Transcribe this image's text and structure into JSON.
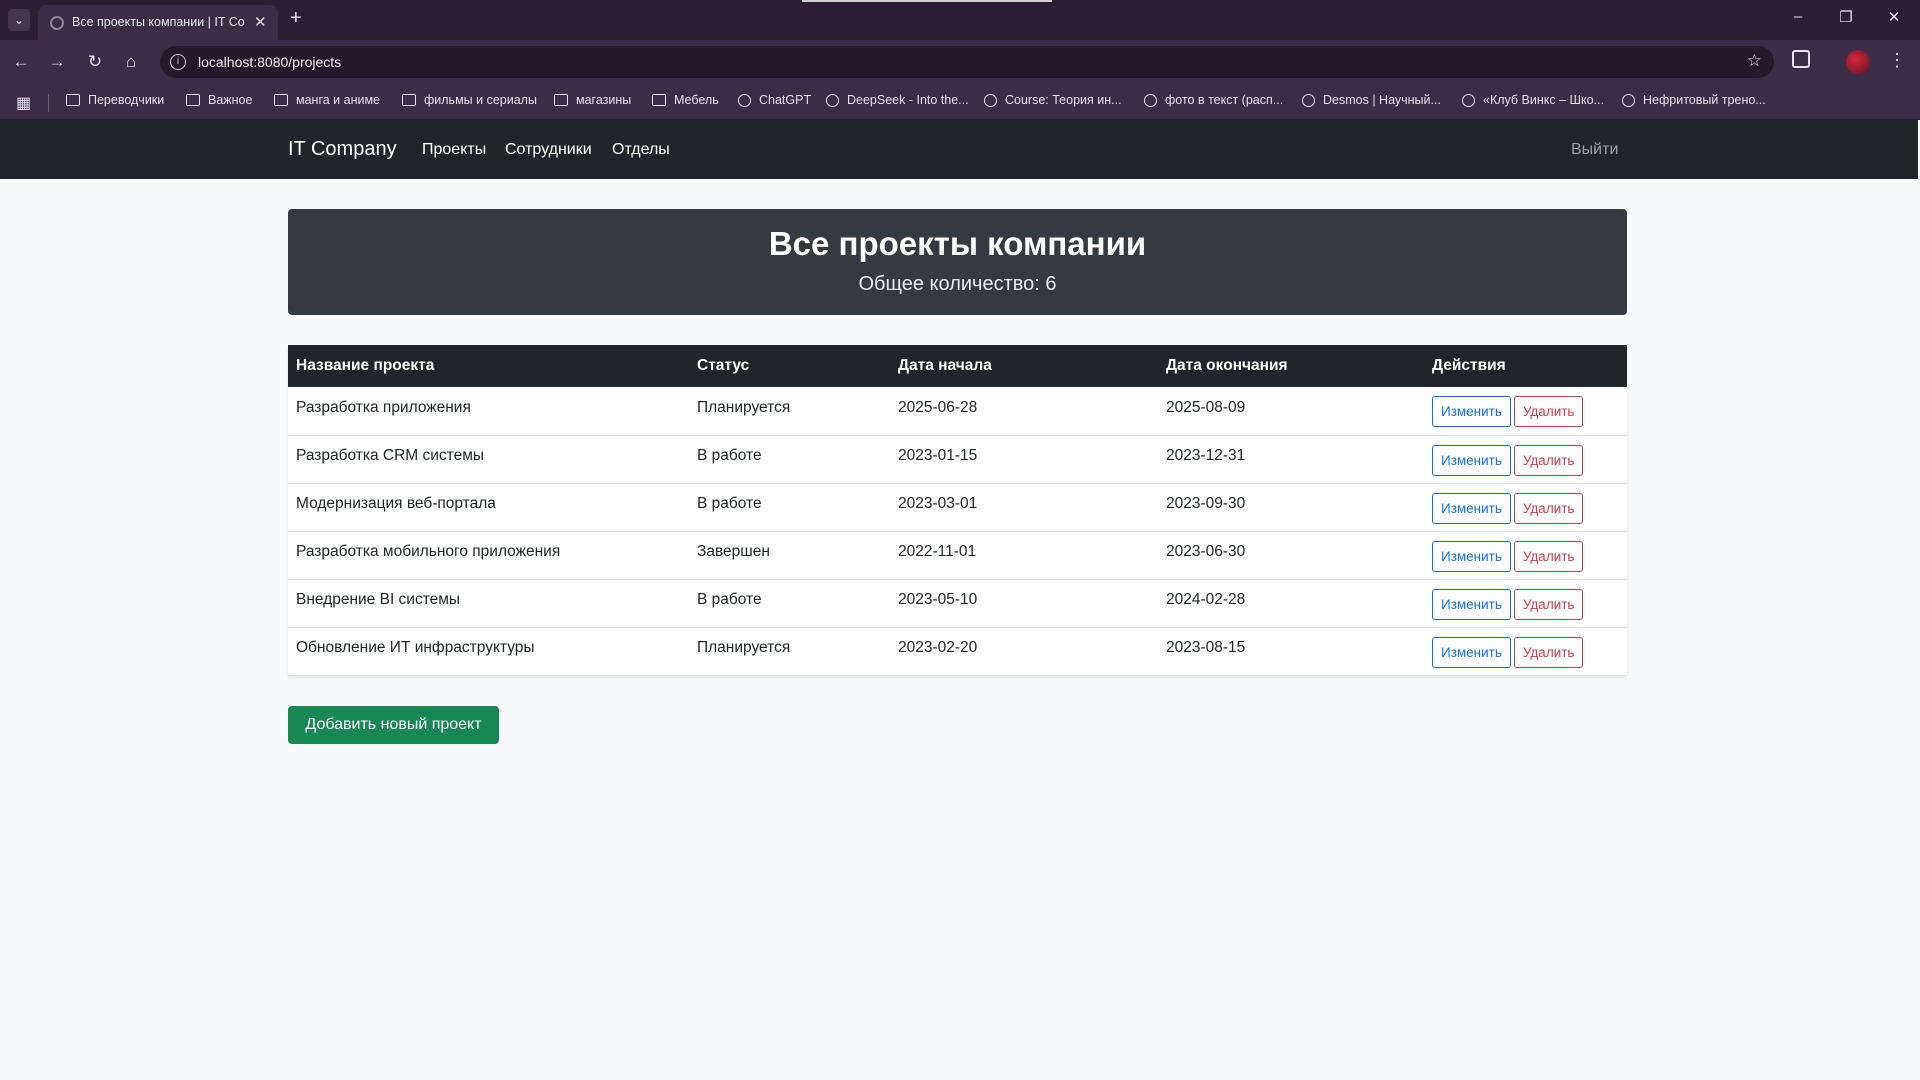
{
  "browser": {
    "tab_title": "Все проекты компании | IT Co",
    "url": "localhost:8080/projects",
    "bookmarks": [
      "Переводчики",
      "Важное",
      "манга и аниме",
      "фильмы и сериалы",
      "магазины",
      "Мебель",
      "ChatGPT",
      "DeepSeek - Into the...",
      "Course: Теория ин...",
      "фото в текст (расп...",
      "Desmos | Научный...",
      "«Клуб Винкс – Шко...",
      "Нефритовый трено..."
    ]
  },
  "navbar": {
    "brand": "IT Company",
    "links": [
      "Проекты",
      "Сотрудники",
      "Отделы"
    ],
    "logout": "Выйти"
  },
  "hero": {
    "title": "Все проекты компании",
    "count": "Общее количество: 6"
  },
  "table": {
    "headers": [
      "Название проекта",
      "Статус",
      "Дата начала",
      "Дата окончания",
      "Действия"
    ],
    "edit_label": "Изменить",
    "delete_label": "Удалить",
    "rows": [
      {
        "name": "Разработка приложения",
        "status": "Планируется",
        "start": "2025-06-28",
        "end": "2025-08-09"
      },
      {
        "name": "Разработка CRM системы",
        "status": "В работе",
        "start": "2023-01-15",
        "end": "2023-12-31"
      },
      {
        "name": "Модернизация веб-портала",
        "status": "В работе",
        "start": "2023-03-01",
        "end": "2023-09-30"
      },
      {
        "name": "Разработка мобильного приложения",
        "status": "Завершен",
        "start": "2022-11-01",
        "end": "2023-06-30"
      },
      {
        "name": "Внедрение BI системы",
        "status": "В работе",
        "start": "2023-05-10",
        "end": "2024-02-28"
      },
      {
        "name": "Обновление ИТ инфраструктуры",
        "status": "Планируется",
        "start": "2023-02-20",
        "end": "2023-08-15"
      }
    ]
  },
  "add_button": "Добавить новый проект"
}
